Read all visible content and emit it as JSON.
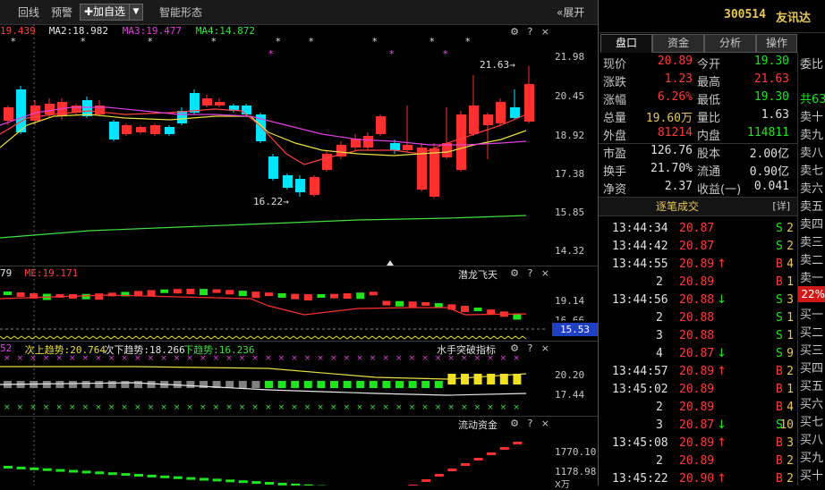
{
  "toolbar": {
    "items": [
      "回线",
      "预警"
    ],
    "add_watch": "✚加自选",
    "dropdown": "▼",
    "smart_form": "智能形态",
    "expand": "«展开"
  },
  "main_chart": {
    "ma_labels": [
      {
        "text": "19.439",
        "color": "#ff4040"
      },
      {
        "text": "MA2:18.982",
        "color": "#e8e8e8"
      },
      {
        "text": "MA3:19.477",
        "color": "#e040e0"
      },
      {
        "text": "MA4:14.872",
        "color": "#40e040"
      }
    ],
    "axis_labels": [
      "21.98",
      "20.45",
      "18.92",
      "17.38",
      "15.85",
      "14.32"
    ],
    "high_annotation": "21.63",
    "low_annotation": "16.22"
  },
  "indicator1": {
    "name": "潜龙飞天",
    "labels": [
      {
        "text": "79",
        "color": "#e8e8e8"
      },
      {
        "text": "ME:19.171",
        "color": "#ff4040"
      }
    ],
    "axis_labels": [
      "19.14",
      "16.66"
    ],
    "price_tag": "15.53"
  },
  "indicator2": {
    "name": "水手突破指标",
    "labels": [
      {
        "text": "52",
        "color": "#e040e0"
      },
      {
        "text": "次上趋势:20.764",
        "color": "#e8e040"
      },
      {
        "text": "次下趋势:18.266",
        "color": "#e8e8e8"
      },
      {
        "text": "下趋势:16.236",
        "color": "#40e040"
      }
    ],
    "axis_labels": [
      "20.20",
      "17.44"
    ]
  },
  "indicator3": {
    "name": "流动资金",
    "axis_labels": [
      "1770.10",
      "1178.98"
    ],
    "unit": "X万"
  },
  "icons": {
    "gear": "⚙",
    "help": "?",
    "close": "×"
  },
  "stock": {
    "code": "300514",
    "name": "友讯达"
  },
  "tabs": [
    "盘口",
    "资金",
    "分析",
    "操作"
  ],
  "quote_rows": [
    [
      {
        "label": "现价",
        "value": "20.89",
        "color": "red"
      },
      {
        "label": "今开",
        "value": "19.30",
        "color": "green"
      }
    ],
    [
      {
        "label": "涨跌",
        "value": "1.23",
        "color": "red"
      },
      {
        "label": "最高",
        "value": "21.63",
        "color": "red"
      }
    ],
    [
      {
        "label": "涨幅",
        "value": "6.26%",
        "color": "red"
      },
      {
        "label": "最低",
        "value": "19.30",
        "color": "green"
      }
    ],
    [
      {
        "label": "总量",
        "value": "19.60万",
        "color": "yellow"
      },
      {
        "label": "量比",
        "value": "1.63",
        "color": "white"
      }
    ],
    [
      {
        "label": "外盘",
        "value": "81214",
        "color": "red"
      },
      {
        "label": "内盘",
        "value": "114811",
        "color": "green"
      }
    ],
    [
      {
        "label": "市盈",
        "value": "126.76",
        "color": "white"
      },
      {
        "label": "股本",
        "value": "2.00亿",
        "color": "white"
      }
    ],
    [
      {
        "label": "换手",
        "value": "21.70%",
        "color": "white"
      },
      {
        "label": "流通",
        "value": "0.90亿",
        "color": "white"
      }
    ],
    [
      {
        "label": "净资",
        "value": "2.37",
        "color": "white"
      },
      {
        "label": "收益(一)",
        "value": "0.041",
        "color": "white"
      }
    ]
  ],
  "order_book": {
    "sell_header": "委比",
    "sell_total": "共63",
    "sell_levels": [
      "卖十",
      "卖九",
      "卖八",
      "卖七",
      "卖六",
      "卖五",
      "卖四",
      "卖三",
      "卖二",
      "卖一"
    ],
    "badge": "22%",
    "buy_levels": [
      "买一",
      "买二",
      "买三",
      "买四",
      "买五",
      "买六",
      "买七",
      "买八",
      "买九",
      "买十"
    ]
  },
  "ticks": {
    "title": "逐笔成交",
    "detail": "[详]",
    "rows": [
      {
        "time": "13:44:34",
        "price": "20.87",
        "arrow": "",
        "vol": "2",
        "side": "S"
      },
      {
        "time": "13:44:42",
        "price": "20.87",
        "arrow": "",
        "vol": "2",
        "side": "S"
      },
      {
        "time": "13:44:55",
        "price": "20.89",
        "arrow": "↑",
        "vol": "4",
        "side": "B"
      },
      {
        "time": "2",
        "price": "20.89",
        "arrow": "",
        "vol": "1",
        "side": "B"
      },
      {
        "time": "13:44:56",
        "price": "20.88",
        "arrow": "↓",
        "vol": "3",
        "side": "S"
      },
      {
        "time": "2",
        "price": "20.88",
        "arrow": "",
        "vol": "1",
        "side": "S"
      },
      {
        "time": "3",
        "price": "20.88",
        "arrow": "",
        "vol": "1",
        "side": "S"
      },
      {
        "time": "4",
        "price": "20.87",
        "arrow": "↓",
        "vol": "9",
        "side": "S"
      },
      {
        "time": "13:44:57",
        "price": "20.89",
        "arrow": "↑",
        "vol": "2",
        "side": "B"
      },
      {
        "time": "13:45:02",
        "price": "20.89",
        "arrow": "",
        "vol": "1",
        "side": "B"
      },
      {
        "time": "2",
        "price": "20.89",
        "arrow": "",
        "vol": "4",
        "side": "B"
      },
      {
        "time": "3",
        "price": "20.87",
        "arrow": "↓",
        "vol": "10",
        "side": "S"
      },
      {
        "time": "13:45:08",
        "price": "20.89",
        "arrow": "↑",
        "vol": "3",
        "side": "B"
      },
      {
        "time": "2",
        "price": "20.89",
        "arrow": "",
        "vol": "2",
        "side": "B"
      },
      {
        "time": "13:45:22",
        "price": "20.90",
        "arrow": "↑",
        "vol": "2",
        "side": "B"
      }
    ]
  },
  "colors": {
    "up": "#ff3b3b",
    "down": "#1ee51e",
    "candle_up_fill": "#ff3030",
    "candle_down_fill": "#00e5ff",
    "accent_tag": "#1f3fc4"
  }
}
